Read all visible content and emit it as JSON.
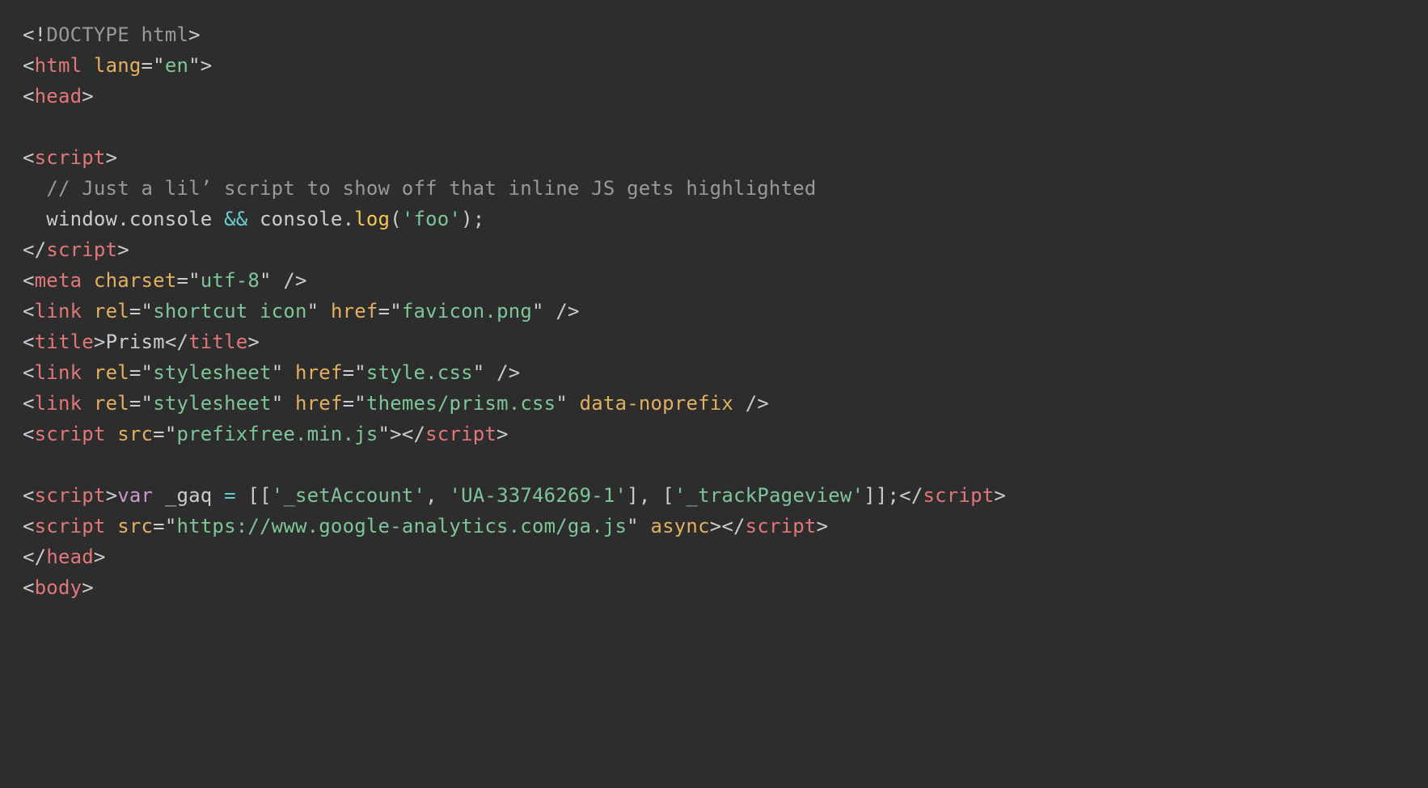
{
  "colors": {
    "background": "#2d2d2d",
    "punctuation": "#cccccc",
    "doctype": "#999999",
    "tag": "#e2777a",
    "attribute": "#e2b060",
    "value": "#7ec699",
    "comment": "#999999",
    "function": "#f8c555",
    "keyword": "#cc99cd",
    "operator": "#67cdcc",
    "string": "#7ec699",
    "plain": "#cccccc"
  },
  "code": {
    "lines": [
      {
        "n": 1,
        "tokens": [
          {
            "cls": "punct",
            "t": "<!"
          },
          {
            "cls": "doctype",
            "t": "DOCTYPE html"
          },
          {
            "cls": "punct",
            "t": ">"
          }
        ]
      },
      {
        "n": 2,
        "tokens": [
          {
            "cls": "punct",
            "t": "<"
          },
          {
            "cls": "tag",
            "t": "html"
          },
          {
            "cls": "plain",
            "t": " "
          },
          {
            "cls": "attr",
            "t": "lang"
          },
          {
            "cls": "punct",
            "t": "=\""
          },
          {
            "cls": "val",
            "t": "en"
          },
          {
            "cls": "punct",
            "t": "\">"
          }
        ]
      },
      {
        "n": 3,
        "tokens": [
          {
            "cls": "punct",
            "t": "<"
          },
          {
            "cls": "tag",
            "t": "head"
          },
          {
            "cls": "punct",
            "t": ">"
          }
        ]
      },
      {
        "n": 4,
        "tokens": []
      },
      {
        "n": 5,
        "tokens": [
          {
            "cls": "punct",
            "t": "<"
          },
          {
            "cls": "tag",
            "t": "script"
          },
          {
            "cls": "punct",
            "t": ">"
          }
        ]
      },
      {
        "n": 6,
        "tokens": [
          {
            "cls": "plain",
            "t": "  "
          },
          {
            "cls": "comment",
            "t": "// Just a lil’ script to show off that inline JS gets highlighted"
          }
        ]
      },
      {
        "n": 7,
        "tokens": [
          {
            "cls": "plain",
            "t": "  window"
          },
          {
            "cls": "punct",
            "t": "."
          },
          {
            "cls": "plain",
            "t": "console "
          },
          {
            "cls": "op",
            "t": "&&"
          },
          {
            "cls": "plain",
            "t": " console"
          },
          {
            "cls": "punct",
            "t": "."
          },
          {
            "cls": "func",
            "t": "log"
          },
          {
            "cls": "punct",
            "t": "("
          },
          {
            "cls": "str",
            "t": "'foo'"
          },
          {
            "cls": "punct",
            "t": ");"
          }
        ]
      },
      {
        "n": 8,
        "tokens": [
          {
            "cls": "punct",
            "t": "</"
          },
          {
            "cls": "tag",
            "t": "script"
          },
          {
            "cls": "punct",
            "t": ">"
          }
        ]
      },
      {
        "n": 9,
        "tokens": [
          {
            "cls": "punct",
            "t": "<"
          },
          {
            "cls": "tag",
            "t": "meta"
          },
          {
            "cls": "plain",
            "t": " "
          },
          {
            "cls": "attr",
            "t": "charset"
          },
          {
            "cls": "punct",
            "t": "=\""
          },
          {
            "cls": "val",
            "t": "utf-8"
          },
          {
            "cls": "punct",
            "t": "\" />"
          }
        ]
      },
      {
        "n": 10,
        "tokens": [
          {
            "cls": "punct",
            "t": "<"
          },
          {
            "cls": "tag",
            "t": "link"
          },
          {
            "cls": "plain",
            "t": " "
          },
          {
            "cls": "attr",
            "t": "rel"
          },
          {
            "cls": "punct",
            "t": "=\""
          },
          {
            "cls": "val",
            "t": "shortcut icon"
          },
          {
            "cls": "punct",
            "t": "\" "
          },
          {
            "cls": "attr",
            "t": "href"
          },
          {
            "cls": "punct",
            "t": "=\""
          },
          {
            "cls": "val",
            "t": "favicon.png"
          },
          {
            "cls": "punct",
            "t": "\" />"
          }
        ]
      },
      {
        "n": 11,
        "tokens": [
          {
            "cls": "punct",
            "t": "<"
          },
          {
            "cls": "tag",
            "t": "title"
          },
          {
            "cls": "punct",
            "t": ">"
          },
          {
            "cls": "plain",
            "t": "Prism"
          },
          {
            "cls": "punct",
            "t": "</"
          },
          {
            "cls": "tag",
            "t": "title"
          },
          {
            "cls": "punct",
            "t": ">"
          }
        ]
      },
      {
        "n": 12,
        "tokens": [
          {
            "cls": "punct",
            "t": "<"
          },
          {
            "cls": "tag",
            "t": "link"
          },
          {
            "cls": "plain",
            "t": " "
          },
          {
            "cls": "attr",
            "t": "rel"
          },
          {
            "cls": "punct",
            "t": "=\""
          },
          {
            "cls": "val",
            "t": "stylesheet"
          },
          {
            "cls": "punct",
            "t": "\" "
          },
          {
            "cls": "attr",
            "t": "href"
          },
          {
            "cls": "punct",
            "t": "=\""
          },
          {
            "cls": "val",
            "t": "style.css"
          },
          {
            "cls": "punct",
            "t": "\" />"
          }
        ]
      },
      {
        "n": 13,
        "tokens": [
          {
            "cls": "punct",
            "t": "<"
          },
          {
            "cls": "tag",
            "t": "link"
          },
          {
            "cls": "plain",
            "t": " "
          },
          {
            "cls": "attr",
            "t": "rel"
          },
          {
            "cls": "punct",
            "t": "=\""
          },
          {
            "cls": "val",
            "t": "stylesheet"
          },
          {
            "cls": "punct",
            "t": "\" "
          },
          {
            "cls": "attr",
            "t": "href"
          },
          {
            "cls": "punct",
            "t": "=\""
          },
          {
            "cls": "val",
            "t": "themes/prism.css"
          },
          {
            "cls": "punct",
            "t": "\" "
          },
          {
            "cls": "attr",
            "t": "data-noprefix"
          },
          {
            "cls": "punct",
            "t": " />"
          }
        ]
      },
      {
        "n": 14,
        "tokens": [
          {
            "cls": "punct",
            "t": "<"
          },
          {
            "cls": "tag",
            "t": "script"
          },
          {
            "cls": "plain",
            "t": " "
          },
          {
            "cls": "attr",
            "t": "src"
          },
          {
            "cls": "punct",
            "t": "=\""
          },
          {
            "cls": "val",
            "t": "prefixfree.min.js"
          },
          {
            "cls": "punct",
            "t": "\"></"
          },
          {
            "cls": "tag",
            "t": "script"
          },
          {
            "cls": "punct",
            "t": ">"
          }
        ]
      },
      {
        "n": 15,
        "tokens": []
      },
      {
        "n": 16,
        "tokens": [
          {
            "cls": "punct",
            "t": "<"
          },
          {
            "cls": "tag",
            "t": "script"
          },
          {
            "cls": "punct",
            "t": ">"
          },
          {
            "cls": "kw",
            "t": "var"
          },
          {
            "cls": "plain",
            "t": " _gaq "
          },
          {
            "cls": "op",
            "t": "="
          },
          {
            "cls": "plain",
            "t": " "
          },
          {
            "cls": "punct",
            "t": "[["
          },
          {
            "cls": "str",
            "t": "'_setAccount'"
          },
          {
            "cls": "punct",
            "t": ", "
          },
          {
            "cls": "str",
            "t": "'UA-33746269-1'"
          },
          {
            "cls": "punct",
            "t": "], ["
          },
          {
            "cls": "str",
            "t": "'_trackPageview'"
          },
          {
            "cls": "punct",
            "t": "]];</"
          },
          {
            "cls": "tag",
            "t": "script"
          },
          {
            "cls": "punct",
            "t": ">"
          }
        ]
      },
      {
        "n": 17,
        "tokens": [
          {
            "cls": "punct",
            "t": "<"
          },
          {
            "cls": "tag",
            "t": "script"
          },
          {
            "cls": "plain",
            "t": " "
          },
          {
            "cls": "attr",
            "t": "src"
          },
          {
            "cls": "punct",
            "t": "=\""
          },
          {
            "cls": "val",
            "t": "https://www.google-analytics.com/ga.js"
          },
          {
            "cls": "punct",
            "t": "\" "
          },
          {
            "cls": "attr",
            "t": "async"
          },
          {
            "cls": "punct",
            "t": "></"
          },
          {
            "cls": "tag",
            "t": "script"
          },
          {
            "cls": "punct",
            "t": ">"
          }
        ]
      },
      {
        "n": 18,
        "tokens": [
          {
            "cls": "punct",
            "t": "</"
          },
          {
            "cls": "tag",
            "t": "head"
          },
          {
            "cls": "punct",
            "t": ">"
          }
        ]
      },
      {
        "n": 19,
        "tokens": [
          {
            "cls": "punct",
            "t": "<"
          },
          {
            "cls": "tag",
            "t": "body"
          },
          {
            "cls": "punct",
            "t": ">"
          }
        ]
      }
    ]
  }
}
